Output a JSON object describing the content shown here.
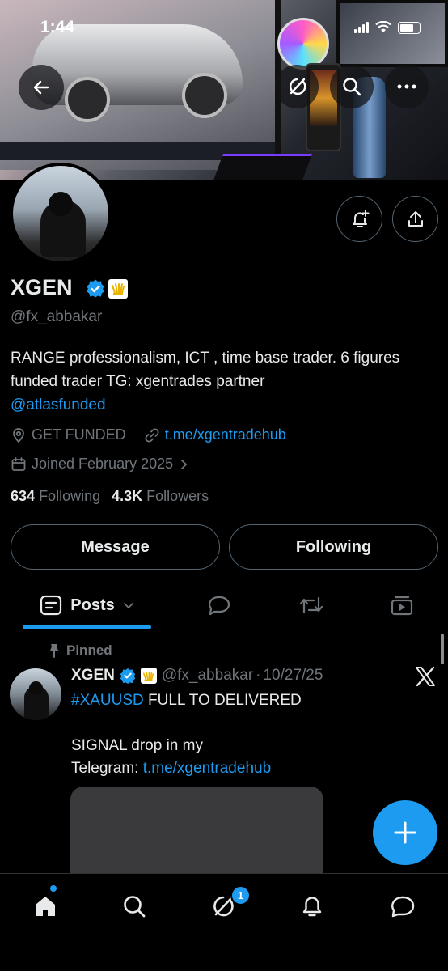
{
  "status_bar": {
    "time": "1:44"
  },
  "header": {
    "back_icon": "arrow-left-icon",
    "grok_icon": "grok-icon",
    "search_icon": "search-icon",
    "more_icon": "more-horizontal-icon"
  },
  "profile": {
    "display_name": "XGEN",
    "handle": "@fx_abbakar",
    "bio_text": "RANGE professionalism, ICT , time base trader. 6 figures funded trader TG: xgentrades partner",
    "bio_mention": "@atlasfunded",
    "category": "GET FUNDED",
    "website": "t.me/xgentradehub",
    "joined": "Joined February 2025",
    "following_count": "634",
    "following_label": "Following",
    "followers_count": "4.3K",
    "followers_label": "Followers"
  },
  "actions": {
    "message_label": "Message",
    "following_label": "Following"
  },
  "tabs": {
    "posts_label": "Posts"
  },
  "post": {
    "pinned_label": "Pinned",
    "author_name": "XGEN",
    "author_handle": "@fx_abbakar",
    "separator": "·",
    "date": "10/27/25",
    "hashtag": "#XAUUSD",
    "line1_rest": " FULL TO DELIVERED",
    "line2": "SIGNAL drop in my",
    "line3_prefix": "Telegram: ",
    "line3_link": "t.me/xgentradehub"
  },
  "bottom_nav": {
    "messages_badge": "1"
  },
  "colors": {
    "accent": "#1d9bf0",
    "muted": "#71767b",
    "text": "#e7e9ea",
    "border": "#2f3336"
  }
}
